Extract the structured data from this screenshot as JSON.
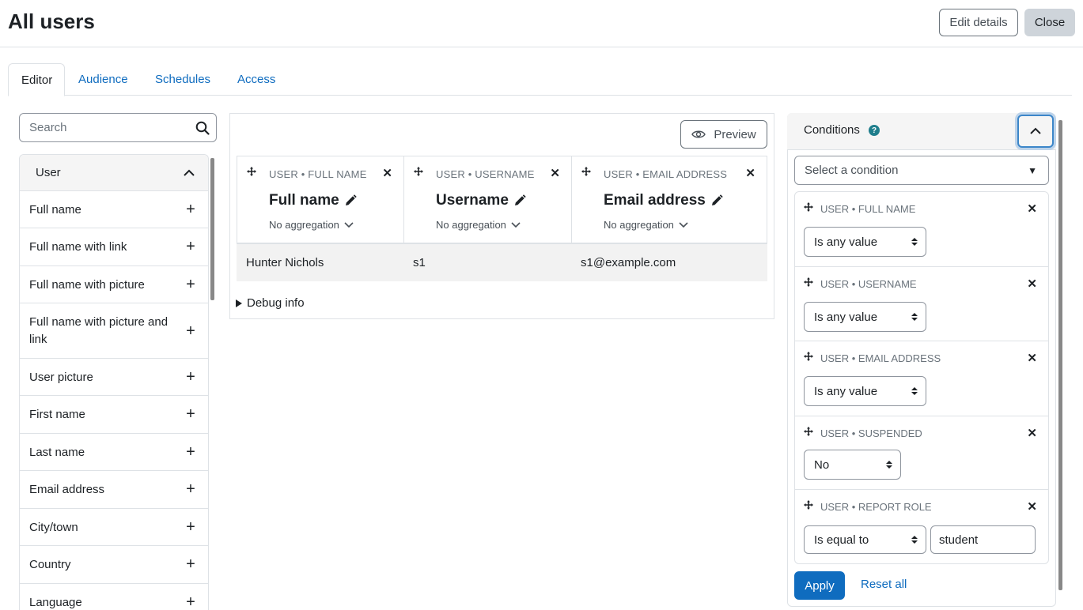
{
  "header": {
    "title": "All users",
    "edit_label": "Edit details",
    "close_label": "Close"
  },
  "tabs": [
    {
      "label": "Editor",
      "active": true
    },
    {
      "label": "Audience"
    },
    {
      "label": "Schedules"
    },
    {
      "label": "Access"
    }
  ],
  "sidebar": {
    "search_placeholder": "Search",
    "section_title": "User",
    "items": [
      {
        "label": "Full name"
      },
      {
        "label": "Full name with link"
      },
      {
        "label": "Full name with picture"
      },
      {
        "label": "Full name with picture and link"
      },
      {
        "label": "User picture"
      },
      {
        "label": "First name"
      },
      {
        "label": "Last name"
      },
      {
        "label": "Email address"
      },
      {
        "label": "City/town"
      },
      {
        "label": "Country"
      },
      {
        "label": "Language"
      }
    ]
  },
  "report": {
    "preview_label": "Preview",
    "columns": [
      {
        "kind": "USER • FULL NAME",
        "name": "Full name",
        "agg": "No aggregation"
      },
      {
        "kind": "USER • USERNAME",
        "name": "Username",
        "agg": "No aggregation"
      },
      {
        "kind": "USER • EMAIL ADDRESS",
        "name": "Email address",
        "agg": "No aggregation"
      }
    ],
    "rows": [
      [
        "Hunter Nichols",
        "s1",
        "s1@example.com"
      ]
    ],
    "debug_label": "Debug info"
  },
  "conditions": {
    "title": "Conditions",
    "help": "?",
    "select_placeholder": "Select a condition",
    "items": [
      {
        "kind": "USER • FULL NAME",
        "operator": "Is any value"
      },
      {
        "kind": "USER • USERNAME",
        "operator": "Is any value"
      },
      {
        "kind": "USER • EMAIL ADDRESS",
        "operator": "Is any value"
      },
      {
        "kind": "USER • SUSPENDED",
        "operator": "No"
      },
      {
        "kind": "USER • REPORT ROLE",
        "operator": "Is equal to",
        "value": "student"
      }
    ],
    "apply_label": "Apply",
    "reset_label": "Reset all"
  }
}
